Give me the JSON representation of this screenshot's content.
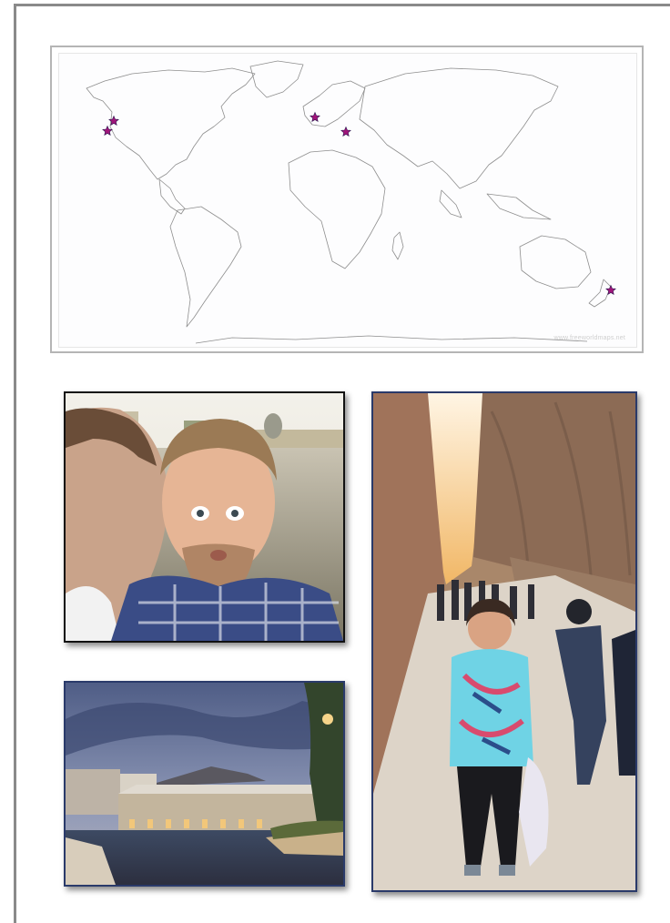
{
  "map": {
    "credit": "www.freeworldmaps.net",
    "marker_color": "#a0157a",
    "markers": [
      {
        "name": "us-west-coast-north"
      },
      {
        "name": "us-west-coast-south"
      },
      {
        "name": "western-europe"
      },
      {
        "name": "central-europe"
      },
      {
        "name": "new-zealand"
      }
    ]
  },
  "photos": [
    {
      "name": "couple-kiss-selfie-river"
    },
    {
      "name": "stone-mill-riverside-dusk"
    },
    {
      "name": "woman-canyon-path"
    }
  ]
}
